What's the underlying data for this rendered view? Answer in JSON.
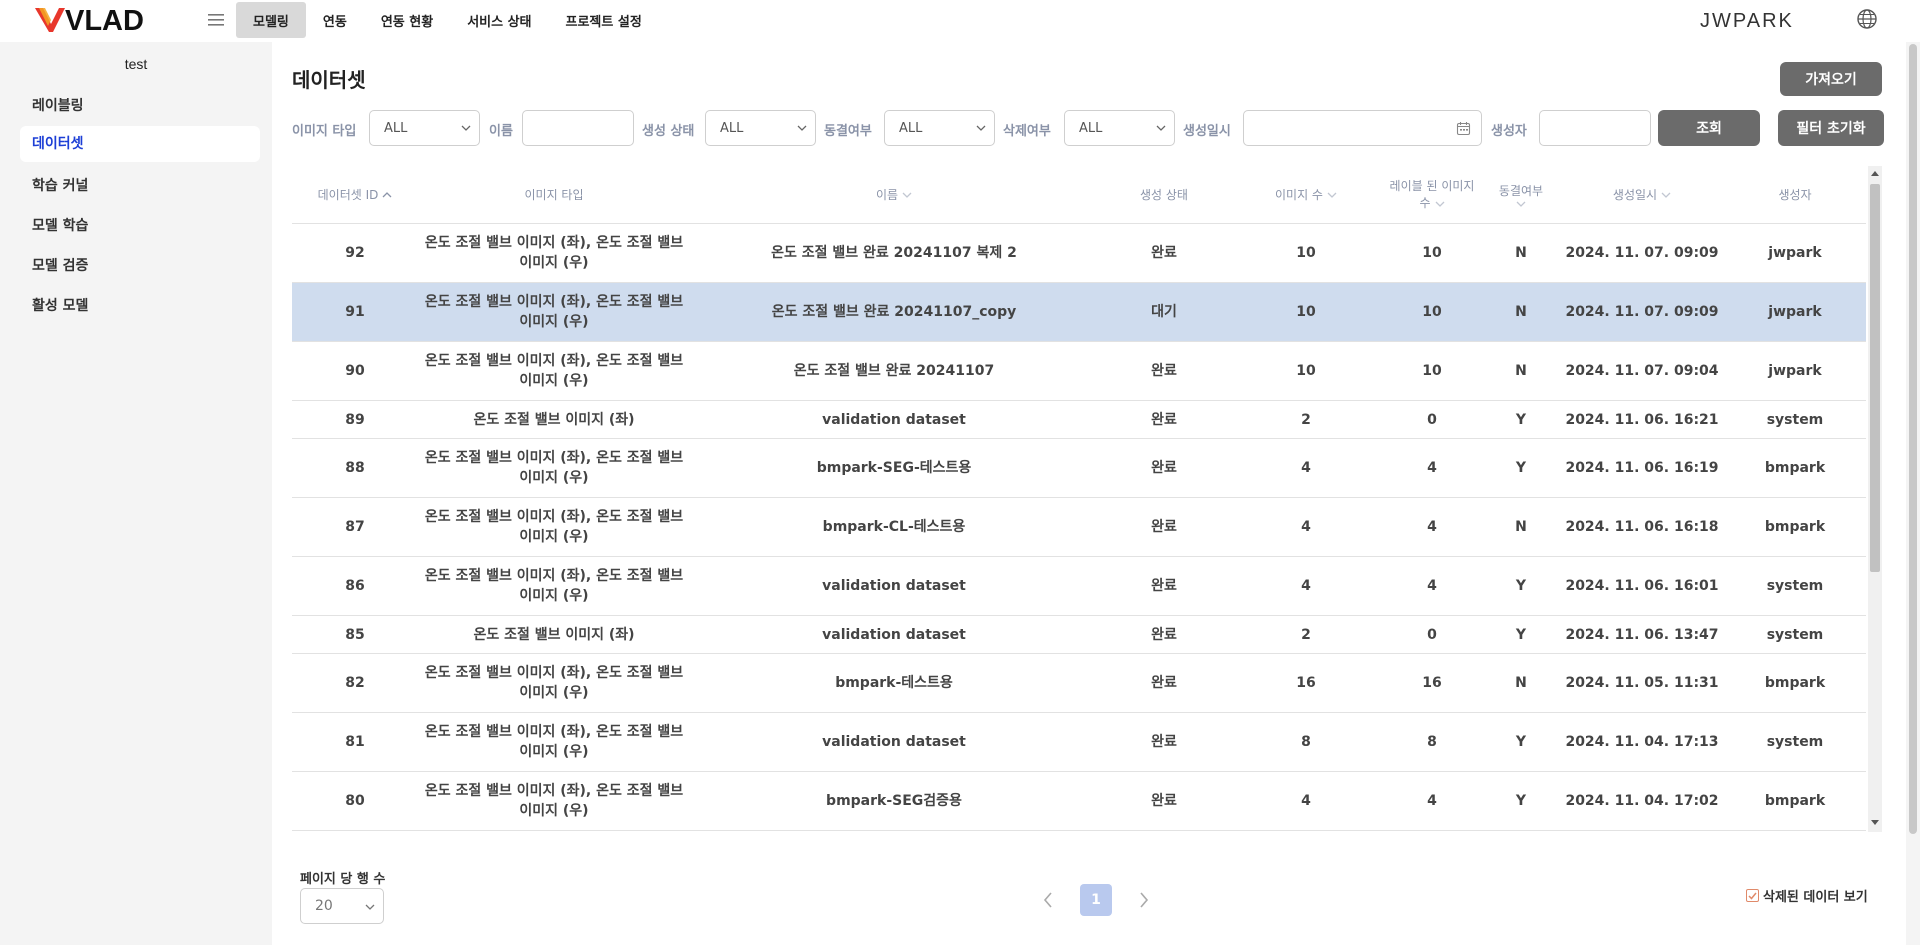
{
  "brand": {
    "logo_text": "VLAD",
    "accent": "#e8372c"
  },
  "nav": {
    "items": [
      {
        "label": "모델링",
        "active": true
      },
      {
        "label": "연동",
        "active": false
      },
      {
        "label": "연동 현황",
        "active": false
      },
      {
        "label": "서비스 상태",
        "active": false
      },
      {
        "label": "프로젝트 설정",
        "active": false
      }
    ]
  },
  "user": {
    "name": "JWPARK"
  },
  "sidebar": {
    "project": "test",
    "items": [
      {
        "label": "레이블링",
        "active": false
      },
      {
        "label": "데이터셋",
        "active": true
      },
      {
        "label": "학습 커널",
        "active": false
      },
      {
        "label": "모델 학습",
        "active": false
      },
      {
        "label": "모델 검증",
        "active": false
      },
      {
        "label": "활성 모델",
        "active": false
      }
    ]
  },
  "page": {
    "title": "데이터셋",
    "import_label": "가져오기",
    "search_label": "조회",
    "reset_label": "필터 초기화"
  },
  "filters": {
    "image_type_label": "이미지 타입",
    "image_type_value": "ALL",
    "name_label": "이름",
    "name_value": "",
    "status_label": "생성 상태",
    "status_value": "ALL",
    "frozen_label": "동결여부",
    "frozen_value": "ALL",
    "deleted_label": "삭제여부",
    "deleted_value": "ALL",
    "created_label": "생성일시",
    "created_value": "",
    "creator_label": "생성자",
    "creator_value": ""
  },
  "table": {
    "headers": {
      "id": "데이터셋 ID",
      "image_type": "이미지 타입",
      "name": "이름",
      "status": "생성 상태",
      "image_count": "이미지 수",
      "labeled_count_1": "레이블 된 이미지",
      "labeled_count_2": "수",
      "frozen": "동결여부",
      "created": "생성일시",
      "creator": "생성자"
    },
    "rows": [
      {
        "id": "92",
        "type1": "온도 조절 밸브 이미지 (좌), 온도 조절 밸브",
        "type2": "이미지 (우)",
        "name": "온도 조절 밸브 완료 20241107 복제 2",
        "status": "완료",
        "images": "10",
        "labeled": "10",
        "frozen": "N",
        "created": "2024. 11. 07. 09:09",
        "creator": "jwpark"
      },
      {
        "id": "91",
        "type1": "온도 조절 밸브 이미지 (좌), 온도 조절 밸브",
        "type2": "이미지 (우)",
        "name": "온도 조절 밸브 완료 20241107_copy",
        "status": "대기",
        "images": "10",
        "labeled": "10",
        "frozen": "N",
        "created": "2024. 11. 07. 09:09",
        "creator": "jwpark",
        "selected": true
      },
      {
        "id": "90",
        "type1": "온도 조절 밸브 이미지 (좌), 온도 조절 밸브",
        "type2": "이미지 (우)",
        "name": "온도 조절 밸브 완료 20241107",
        "status": "완료",
        "images": "10",
        "labeled": "10",
        "frozen": "N",
        "created": "2024. 11. 07. 09:04",
        "creator": "jwpark"
      },
      {
        "id": "89",
        "type1": "온도 조절 밸브 이미지 (좌)",
        "type2": "",
        "name": "validation dataset",
        "status": "완료",
        "images": "2",
        "labeled": "0",
        "frozen": "Y",
        "created": "2024. 11. 06. 16:21",
        "creator": "system"
      },
      {
        "id": "88",
        "type1": "온도 조절 밸브 이미지 (좌), 온도 조절 밸브",
        "type2": "이미지 (우)",
        "name": "bmpark-SEG-테스트용",
        "status": "완료",
        "images": "4",
        "labeled": "4",
        "frozen": "Y",
        "created": "2024. 11. 06. 16:19",
        "creator": "bmpark"
      },
      {
        "id": "87",
        "type1": "온도 조절 밸브 이미지 (좌), 온도 조절 밸브",
        "type2": "이미지 (우)",
        "name": "bmpark-CL-테스트용",
        "status": "완료",
        "images": "4",
        "labeled": "4",
        "frozen": "N",
        "created": "2024. 11. 06. 16:18",
        "creator": "bmpark"
      },
      {
        "id": "86",
        "type1": "온도 조절 밸브 이미지 (좌), 온도 조절 밸브",
        "type2": "이미지 (우)",
        "name": "validation dataset",
        "status": "완료",
        "images": "4",
        "labeled": "4",
        "frozen": "Y",
        "created": "2024. 11. 06. 16:01",
        "creator": "system"
      },
      {
        "id": "85",
        "type1": "온도 조절 밸브 이미지 (좌)",
        "type2": "",
        "name": "validation dataset",
        "status": "완료",
        "images": "2",
        "labeled": "0",
        "frozen": "Y",
        "created": "2024. 11. 06. 13:47",
        "creator": "system"
      },
      {
        "id": "82",
        "type1": "온도 조절 밸브 이미지 (좌), 온도 조절 밸브",
        "type2": "이미지 (우)",
        "name": "bmpark-테스트용",
        "status": "완료",
        "images": "16",
        "labeled": "16",
        "frozen": "N",
        "created": "2024. 11. 05. 11:31",
        "creator": "bmpark"
      },
      {
        "id": "81",
        "type1": "온도 조절 밸브 이미지 (좌), 온도 조절 밸브",
        "type2": "이미지 (우)",
        "name": "validation dataset",
        "status": "완료",
        "images": "8",
        "labeled": "8",
        "frozen": "Y",
        "created": "2024. 11. 04. 17:13",
        "creator": "system"
      },
      {
        "id": "80",
        "type1": "온도 조절 밸브 이미지 (좌), 온도 조절 밸브",
        "type2": "이미지 (우)",
        "name": "bmpark-SEG검증용",
        "status": "완료",
        "images": "4",
        "labeled": "4",
        "frozen": "Y",
        "created": "2024. 11. 04. 17:02",
        "creator": "bmpark"
      }
    ]
  },
  "pagination": {
    "rows_label": "페이지 당 행 수",
    "rows_value": "20",
    "current_page": "1",
    "show_deleted_label": "삭제된 데이터 보기",
    "show_deleted_checked": true
  }
}
